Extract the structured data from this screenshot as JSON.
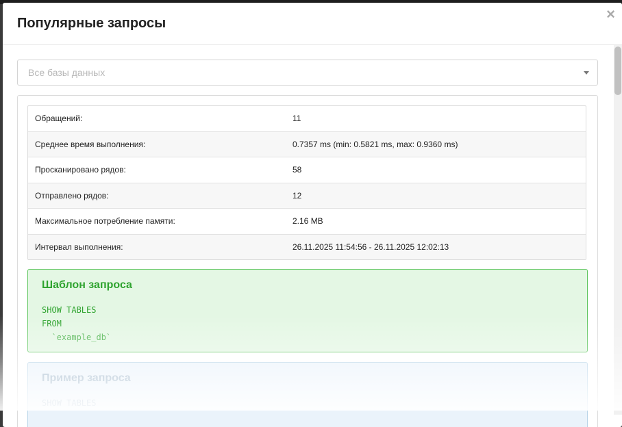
{
  "modal": {
    "title": "Популярные запросы",
    "close_glyph": "×"
  },
  "db_select": {
    "placeholder": "Все базы данных"
  },
  "stats": [
    {
      "label": "Обращений:",
      "value": "11"
    },
    {
      "label": "Среднее время выполнения:",
      "value": "0.7357 ms (min: 0.5821 ms, max: 0.9360 ms)"
    },
    {
      "label": "Просканировано рядов:",
      "value": "58"
    },
    {
      "label": "Отправлено рядов:",
      "value": "12"
    },
    {
      "label": "Максимальное потребление памяти:",
      "value": "2.16 MB"
    },
    {
      "label": "Интервал выполнения:",
      "value": "26.11.2025 11:54:56 - 26.11.2025 12:02:13"
    }
  ],
  "template": {
    "title": "Шаблон запроса",
    "lines": [
      "SHOW TABLES",
      "FROM",
      "  `example_db`"
    ]
  },
  "example": {
    "title": "Пример запроса",
    "lines": [
      "SHOW TABLES"
    ]
  },
  "colors": {
    "template_accent": "#2ea32e",
    "example_accent": "#9cb4c8"
  }
}
